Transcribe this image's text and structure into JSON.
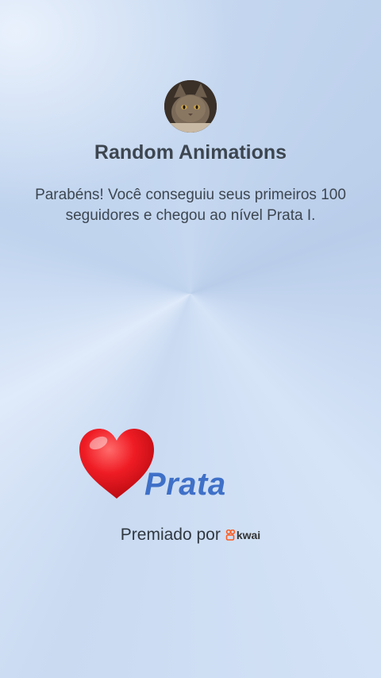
{
  "profile": {
    "avatar_icon": "cat-avatar",
    "name": "Random Animations"
  },
  "message": "Parabéns! Você conseguiu seus primeiros 100 seguidores e chegou ao nível Prata I.",
  "badge": {
    "icon": "red-heart-icon",
    "level_label": "Prata"
  },
  "awarded_by": {
    "label": "Premiado por",
    "brand_icon": "kwai-logo-icon",
    "brand": "kwai"
  },
  "colors": {
    "accent": "#3f70c8",
    "heart": "#e0151f",
    "text": "#3d4650"
  }
}
